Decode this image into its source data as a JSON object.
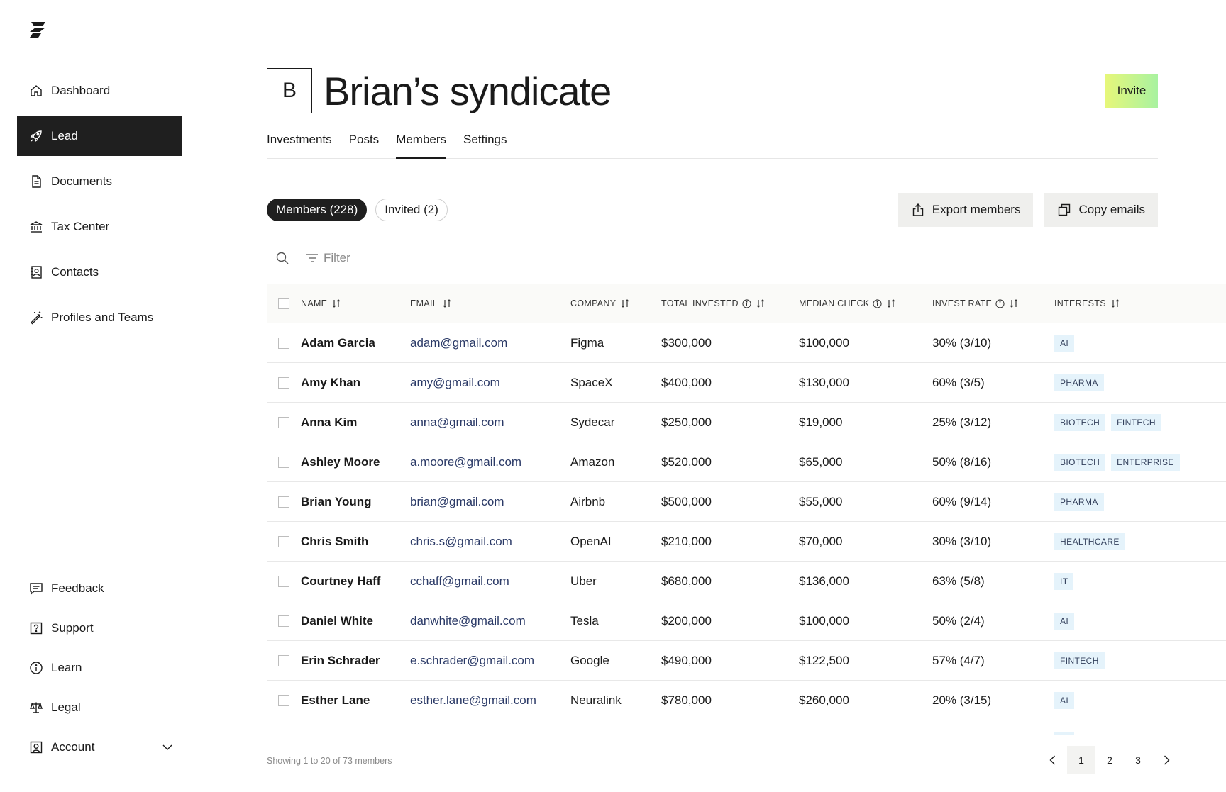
{
  "sidebar": {
    "logo_icon": "sydecar-logo-icon",
    "items": [
      {
        "label": "Dashboard",
        "icon": "home-icon"
      },
      {
        "label": "Lead",
        "icon": "rocket-icon"
      },
      {
        "label": "Documents",
        "icon": "document-icon"
      },
      {
        "label": "Tax Center",
        "icon": "bank-icon"
      },
      {
        "label": "Contacts",
        "icon": "contacts-icon"
      },
      {
        "label": "Profiles and Teams",
        "icon": "magic-wand-icon"
      }
    ],
    "bottom_items": [
      {
        "label": "Feedback",
        "icon": "chat-icon"
      },
      {
        "label": "Support",
        "icon": "help-icon"
      },
      {
        "label": "Learn",
        "icon": "info-icon"
      },
      {
        "label": "Legal",
        "icon": "scales-icon"
      },
      {
        "label": "Account",
        "icon": "account-icon"
      }
    ]
  },
  "header": {
    "avatar_letter": "B",
    "title": "Brian’s syndicate",
    "invite_label": "Invite",
    "invite_gradient": [
      "#e6f77a",
      "#a8f2a0"
    ]
  },
  "tabs": [
    {
      "label": "Investments"
    },
    {
      "label": "Posts"
    },
    {
      "label": "Members",
      "active": true
    },
    {
      "label": "Settings"
    }
  ],
  "pills": [
    {
      "label": "Members (228)",
      "active": true
    },
    {
      "label": "Invited (2)"
    }
  ],
  "actions": {
    "export_label": "Export members",
    "copy_label": "Copy emails"
  },
  "filter": {
    "label": "Filter"
  },
  "table": {
    "columns": {
      "name": "NAME",
      "email": "EMAIL",
      "company": "COMPANY",
      "total": "TOTAL INVESTED",
      "median": "MEDIAN CHECK",
      "rate": "INVEST RATE",
      "interests": "INTERESTS"
    },
    "rows": [
      {
        "name": "Adam Garcia",
        "email": "adam@gmail.com",
        "company": "Figma",
        "total": "$300,000",
        "median": "$100,000",
        "rate": "30% (3/10)",
        "interests": [
          "AI"
        ]
      },
      {
        "name": "Amy Khan",
        "email": "amy@gmail.com",
        "company": "SpaceX",
        "total": "$400,000",
        "median": "$130,000",
        "rate": "60% (3/5)",
        "interests": [
          "PHARMA"
        ]
      },
      {
        "name": "Anna Kim",
        "email": "anna@gmail.com",
        "company": "Sydecar",
        "total": "$250,000",
        "median": "$19,000",
        "rate": "25% (3/12)",
        "interests": [
          "BIOTECH",
          "FINTECH"
        ]
      },
      {
        "name": "Ashley Moore",
        "email": "a.moore@gmail.com",
        "company": "Amazon",
        "total": "$520,000",
        "median": "$65,000",
        "rate": "50% (8/16)",
        "interests": [
          "BIOTECH",
          "ENTERPRISE"
        ]
      },
      {
        "name": "Brian Young",
        "email": "brian@gmail.com",
        "company": "Airbnb",
        "total": "$500,000",
        "median": "$55,000",
        "rate": "60% (9/14)",
        "interests": [
          "PHARMA"
        ]
      },
      {
        "name": "Chris Smith",
        "email": "chris.s@gmail.com",
        "company": "OpenAI",
        "total": "$210,000",
        "median": "$70,000",
        "rate": "30% (3/10)",
        "interests": [
          "HEALTHCARE"
        ]
      },
      {
        "name": "Courtney Haff",
        "email": "cchaff@gmail.com",
        "company": "Uber",
        "total": "$680,000",
        "median": "$136,000",
        "rate": "63% (5/8)",
        "interests": [
          "IT"
        ]
      },
      {
        "name": "Daniel White",
        "email": "danwhite@gmail.com",
        "company": "Tesla",
        "total": "$200,000",
        "median": "$100,000",
        "rate": "50% (2/4)",
        "interests": [
          "AI"
        ]
      },
      {
        "name": "Erin Schrader",
        "email": "e.schrader@gmail.com",
        "company": "Google",
        "total": "$490,000",
        "median": "$122,500",
        "rate": "57% (4/7)",
        "interests": [
          "FINTECH"
        ]
      },
      {
        "name": "Esther Lane",
        "email": "esther.lane@gmail.com",
        "company": "Neuralink",
        "total": "$780,000",
        "median": "$260,000",
        "rate": "20% (3/15)",
        "interests": [
          "AI"
        ]
      }
    ]
  },
  "footer": {
    "showing_text": "Showing 1 to 20 of 73 members",
    "pages": [
      "1",
      "2",
      "3"
    ],
    "current_page": "1"
  },
  "colors": {
    "active_nav_bg": "#1f1f1f",
    "tag_bg": "#e5f3fb",
    "email_text": "#2b3a67"
  }
}
